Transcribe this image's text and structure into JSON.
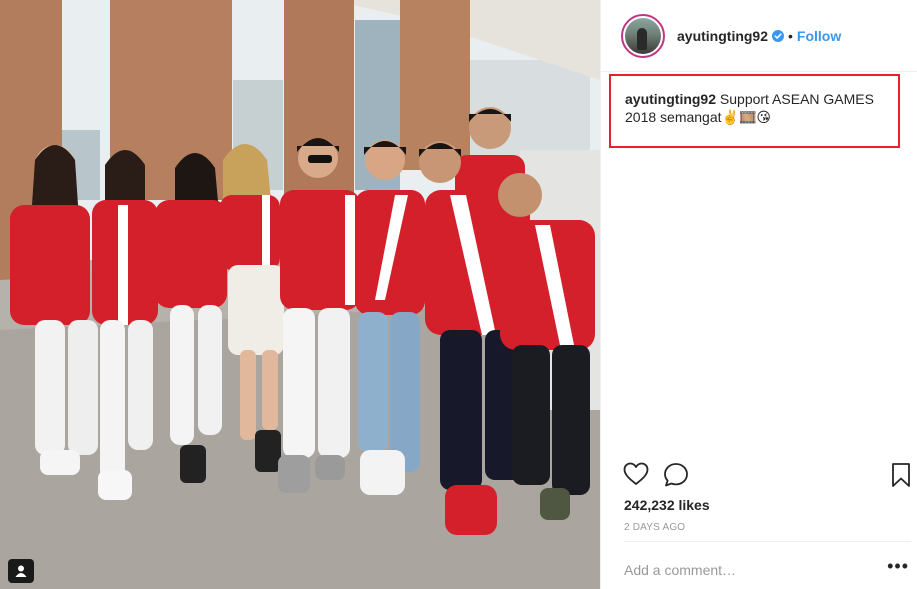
{
  "post": {
    "username": "ayutingting92",
    "follow_label": "Follow",
    "separator": "•",
    "caption_user": "ayutingting92",
    "caption_text": " Support ASEAN GAMES 2018 semangat✌️🎞️😘",
    "likes": "242,232 likes",
    "time": "2 DAYS AGO",
    "comment_placeholder": "Add a comment…",
    "more_label": "•••"
  },
  "icons": {
    "verified": "verified-badge-icon",
    "like": "heart-icon",
    "comment": "comment-bubble-icon",
    "save": "bookmark-icon",
    "tag": "user-tag-icon"
  },
  "colors": {
    "link": "#3897f0",
    "highlight_border": "#e0242e",
    "shirt_red": "#d4202a"
  }
}
